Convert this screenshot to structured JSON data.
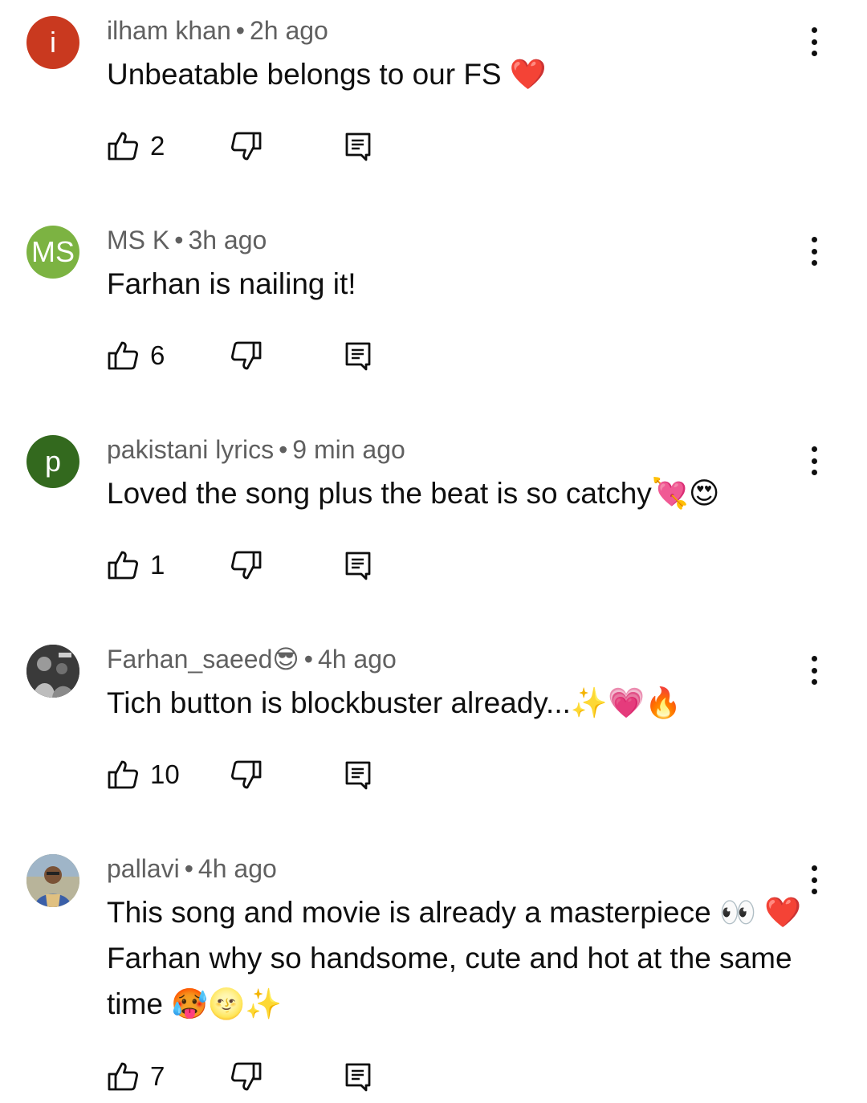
{
  "comments": [
    {
      "author": "ilham khan",
      "time": "2h ago",
      "text": "Unbeatable belongs to our FS ❤️",
      "likes": "2",
      "avatar_letter": "i",
      "avatar_color": "#c9391f"
    },
    {
      "author": "MS K",
      "time": "3h ago",
      "text": "Farhan is nailing it!",
      "likes": "6",
      "avatar_letter": "MS",
      "avatar_color": "#7cb342"
    },
    {
      "author": "pakistani lyrics",
      "time": "9 min ago",
      "text": "Loved the song plus the beat is so catchy💘😍",
      "likes": "1",
      "avatar_letter": "p",
      "avatar_color": "#33691e"
    },
    {
      "author": "Farhan_saeed😎",
      "time": "4h ago",
      "text": "Tich button is blockbuster already...✨💗🔥",
      "likes": "10",
      "avatar_letter": "",
      "avatar_color": "#2b2b2b"
    },
    {
      "author": "pallavi",
      "time": "4h ago",
      "text": "This song and movie is already a masterpiece  👀 ❤️ Farhan why so handsome, cute and hot at the same time 🥵🌝✨",
      "likes": "7",
      "avatar_letter": "",
      "avatar_color": "#8a8f6a"
    }
  ],
  "separator": "•",
  "icons": {
    "like": "thumbs-up-icon",
    "dislike": "thumbs-down-icon",
    "reply": "reply-icon",
    "menu": "more-vertical-icon"
  }
}
